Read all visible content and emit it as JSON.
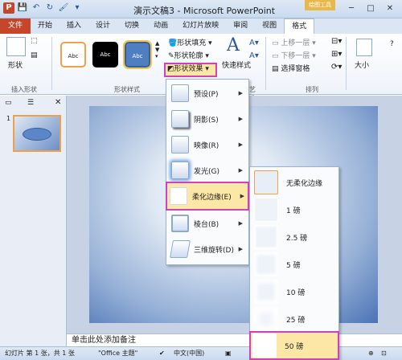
{
  "qat": {
    "app": "P",
    "save": "💾",
    "undo": "↶",
    "redo": "↻",
    "brush": "🖌",
    "more": "▾"
  },
  "title": "演示文稿3 - Microsoft PowerPoint",
  "context_tool": "绘图工具",
  "tabs": [
    "开始",
    "插入",
    "设计",
    "切换",
    "动画",
    "幻灯片放映",
    "审阅",
    "视图",
    "格式"
  ],
  "file_tab": "文件",
  "ribbon": {
    "shape_btn": "形状",
    "insert_group": "插入形状",
    "styles": [
      "Abc",
      "Abc",
      "Abc"
    ],
    "fill": "形状填充",
    "outline": "形状轮廓",
    "effects": "形状效果",
    "styles_group": "形状样式",
    "quick_styles": "快速样式",
    "wordart_group": "艺术字样式",
    "bring_forward": "上移一层",
    "send_backward": "下移一层",
    "selection_pane": "选择窗格",
    "arrange_group": "排列",
    "size": "大小"
  },
  "slide_num": "1",
  "notes": "单击此处添加备注",
  "status": {
    "slide": "幻灯片 第 1 张，共 1 张",
    "theme": "\"Office 主题\"",
    "lang": "中文(中国)"
  },
  "menu1": [
    {
      "label": "预设(P)"
    },
    {
      "label": "阴影(S)"
    },
    {
      "label": "映像(R)"
    },
    {
      "label": "发光(G)"
    },
    {
      "label": "柔化边缘(E)"
    },
    {
      "label": "棱台(B)"
    },
    {
      "label": "三维旋转(D)"
    }
  ],
  "menu2": [
    {
      "label": "无柔化边缘"
    },
    {
      "label": "1 磅"
    },
    {
      "label": "2.5 磅"
    },
    {
      "label": "5 磅"
    },
    {
      "label": "10 磅"
    },
    {
      "label": "25 磅"
    },
    {
      "label": "50 磅"
    }
  ],
  "colors": {
    "accent": "#c6452b",
    "highlight": "#d23fc0"
  }
}
